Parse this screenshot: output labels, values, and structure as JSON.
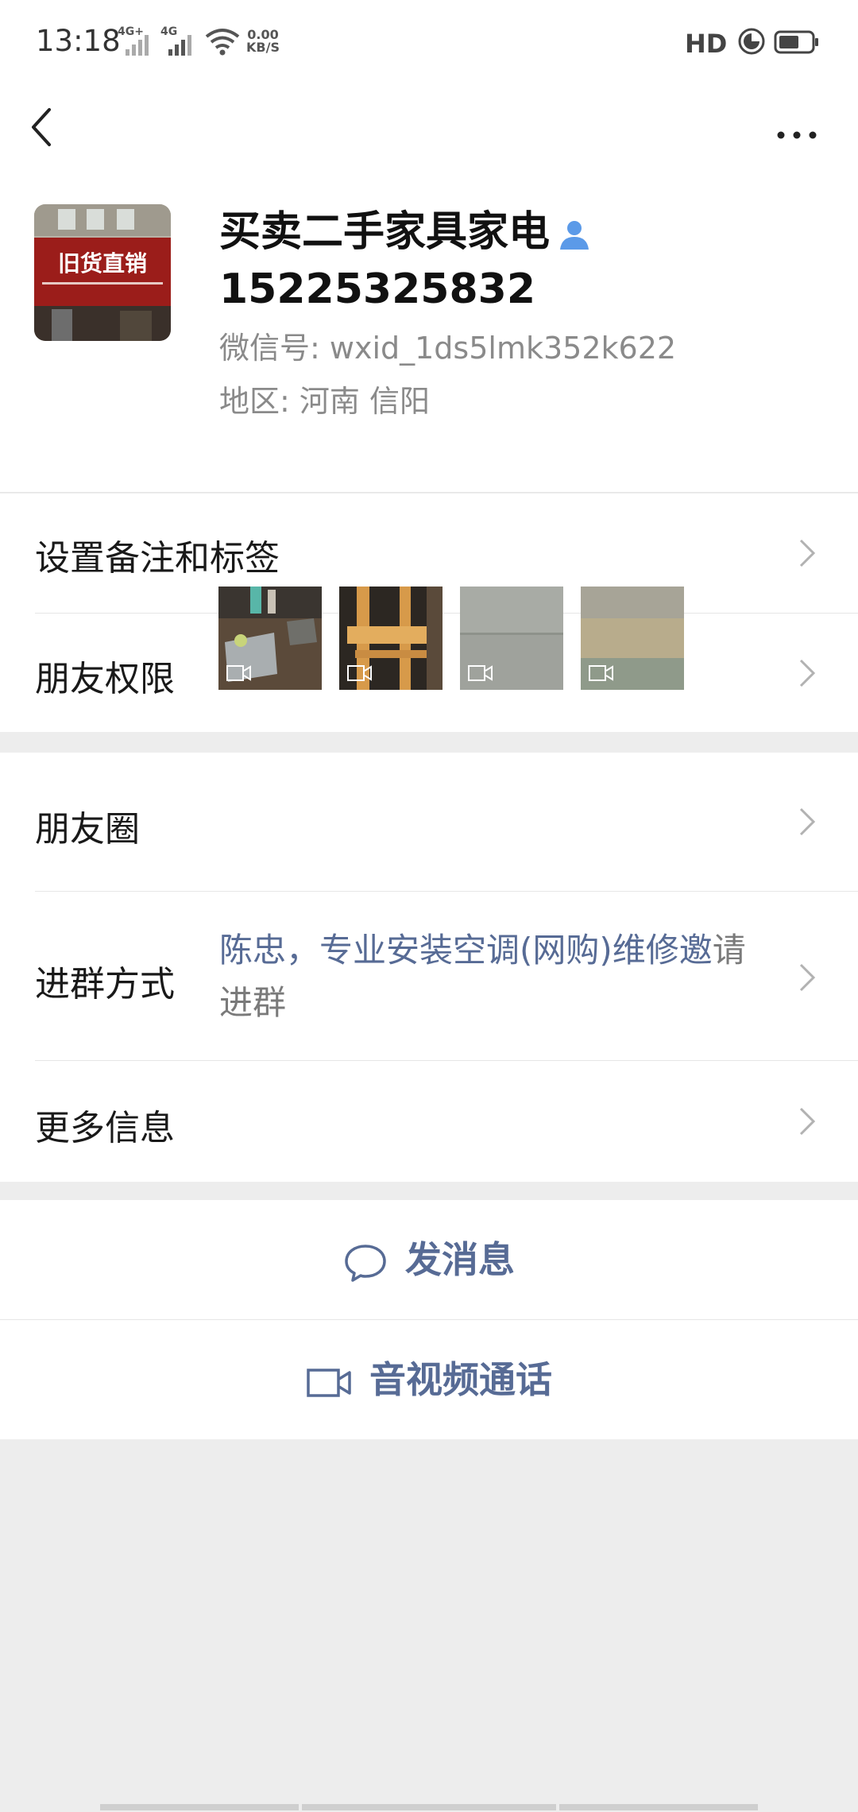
{
  "status_bar": {
    "time": "13:18",
    "sim1": "4G+",
    "sim2": "4G",
    "net_speed_value": "0.00",
    "net_speed_unit": "KB/S",
    "hd": "HD"
  },
  "profile": {
    "name": "买卖二手家具家电",
    "phone": "15225325832",
    "wechat_id": "微信号: wxid_1ds5lmk352k622",
    "region": "地区: 河南  信阳",
    "avatar_sign_text": "旧货直销"
  },
  "rows": {
    "remark_tags": "设置备注和标签",
    "friend_permissions": "朋友权限",
    "moments": "朋友圈",
    "join_group_label": "进群方式",
    "join_group_link": "陈忠，专业安装空调(网购)维修邀",
    "join_group_rest": "请进群",
    "more_info": "更多信息"
  },
  "actions": {
    "send_message": "发消息",
    "video_call": "音视频通话"
  },
  "colors": {
    "link": "#576b95",
    "background": "#ededed",
    "verified_icon": "#5b9ae8"
  },
  "icons": [
    "back-arrow-icon",
    "more-dots-icon",
    "person-verified-icon",
    "chevron-right-icon",
    "chat-bubble-icon",
    "video-camera-icon"
  ]
}
